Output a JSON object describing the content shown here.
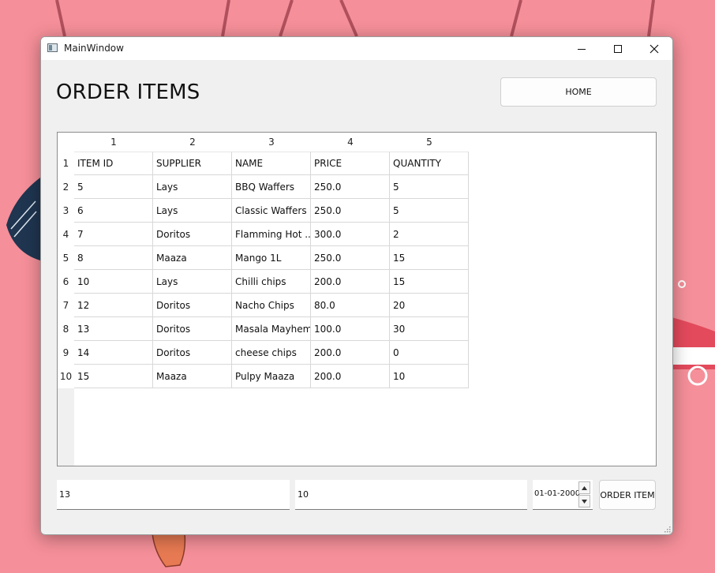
{
  "window": {
    "title": "MainWindow"
  },
  "header": {
    "title": "ORDER ITEMS",
    "home_label": "HOME"
  },
  "table": {
    "column_headers": [
      "1",
      "2",
      "3",
      "4",
      "5"
    ],
    "row_headers": [
      "1",
      "2",
      "3",
      "4",
      "5",
      "6",
      "7",
      "8",
      "9",
      "10"
    ],
    "rows": [
      [
        "ITEM ID",
        "SUPPLIER",
        "NAME",
        "PRICE",
        "QUANTITY"
      ],
      [
        "5",
        "Lays",
        "BBQ Waffers",
        "250.0",
        "5"
      ],
      [
        "6",
        "Lays",
        "Classic Waffers",
        "250.0",
        "5"
      ],
      [
        "7",
        "Doritos",
        "Flamming Hot ...",
        "300.0",
        "2"
      ],
      [
        "8",
        "Maaza",
        "Mango 1L",
        "250.0",
        "15"
      ],
      [
        "10",
        "Lays",
        "Chilli chips",
        "200.0",
        "15"
      ],
      [
        "12",
        "Doritos",
        "Nacho Chips",
        "80.0",
        "20"
      ],
      [
        "13",
        "Doritos",
        "Masala Mayhem",
        "100.0",
        "30"
      ],
      [
        "14",
        "Doritos",
        "cheese chips",
        "200.0",
        "0"
      ],
      [
        "15",
        "Maaza",
        "Pulpy Maaza",
        "200.0",
        "10"
      ]
    ]
  },
  "form": {
    "item_id_value": "13",
    "quantity_value": "10",
    "date_value": "01-01-2000",
    "order_label": "ORDER ITEM"
  },
  "icons": {
    "app": "app-window-icon",
    "minimize": "minimize-icon",
    "maximize": "maximize-icon",
    "close": "close-icon",
    "spin_up": "arrow-up-icon",
    "spin_down": "arrow-down-icon",
    "resize": "resize-grip-icon"
  },
  "colors": {
    "desktop": "#f58f99",
    "window": "#f0f0f0"
  }
}
